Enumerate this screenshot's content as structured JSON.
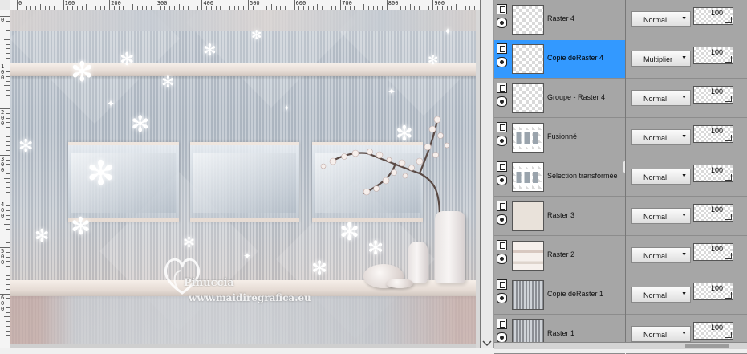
{
  "ruler": {
    "top_labels": [
      "0",
      "100",
      "200",
      "300",
      "400",
      "500",
      "600",
      "700",
      "800",
      "900"
    ],
    "left_labels": [
      "0",
      "100",
      "200",
      "300",
      "400",
      "500",
      "600"
    ]
  },
  "watermark": {
    "name": "Pinuccia",
    "site": "www.maidiregrafica.eu"
  },
  "layers": [
    {
      "name": "Raster 4",
      "thumb": "transparent",
      "selected": false,
      "blend": "Normal",
      "opacity": "100"
    },
    {
      "name": "Copie deRaster 4",
      "thumb": "transparent",
      "selected": true,
      "blend": "Multiplier",
      "opacity": "100"
    },
    {
      "name": "Groupe - Raster 4",
      "thumb": "transparent",
      "selected": false,
      "blend": "Normal",
      "opacity": "100"
    },
    {
      "name": "Fusionné",
      "thumb": "frames",
      "selected": false,
      "blend": "Normal",
      "opacity": "100"
    },
    {
      "name": "Sélection transformée",
      "thumb": "frames",
      "selected": false,
      "blend": "Normal",
      "opacity": "100"
    },
    {
      "name": "Raster 3",
      "thumb": "solid",
      "selected": false,
      "blend": "Normal",
      "opacity": "100"
    },
    {
      "name": "Raster 2",
      "thumb": "soft",
      "selected": false,
      "blend": "Normal",
      "opacity": "100"
    },
    {
      "name": "Copie deRaster 1",
      "thumb": "stripes",
      "selected": false,
      "blend": "Normal",
      "opacity": "100"
    },
    {
      "name": "Raster 1",
      "thumb": "stripes",
      "selected": false,
      "blend": "Normal",
      "opacity": "100"
    }
  ],
  "icons": {
    "visibility": "eye-icon",
    "layer_type": "raster-layer-icon",
    "dropdown": "chevron-down-icon"
  },
  "colors": {
    "selected_row": "#3399ff",
    "panel_bg": "#a6a6a6"
  }
}
